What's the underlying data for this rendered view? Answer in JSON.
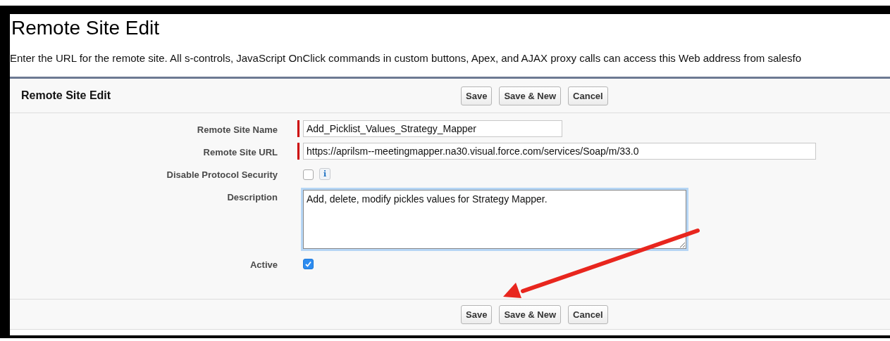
{
  "page_title": "Remote Site Edit",
  "intro": "Enter the URL for the remote site. All s-controls, JavaScript OnClick commands in custom buttons, Apex, and AJAX proxy calls can access this Web address from salesfo",
  "panel": {
    "title": "Remote Site Edit",
    "top_buttons": [
      "Save",
      "Save & New",
      "Cancel"
    ],
    "fields": [
      {
        "kind": "text",
        "label": "Remote Site Name",
        "value": "Add_Picklist_Values_Strategy_Mapper",
        "required": true,
        "wide": false
      },
      {
        "kind": "text",
        "label": "Remote Site URL",
        "value": "https://aprilsm--meetingmapper.na30.visual.force.com/services/Soap/m/33.0",
        "required": true,
        "wide": true
      },
      {
        "kind": "checkbox",
        "label": "Disable Protocol Security",
        "checked": false,
        "info": "i"
      },
      {
        "kind": "textarea",
        "label": "Description",
        "value": "Add, delete, modify pickles values for Strategy Mapper. "
      },
      {
        "kind": "checkbox",
        "label": "Active",
        "checked": true
      }
    ],
    "bottom_buttons": [
      "Save",
      "Save & New",
      "Cancel"
    ]
  }
}
